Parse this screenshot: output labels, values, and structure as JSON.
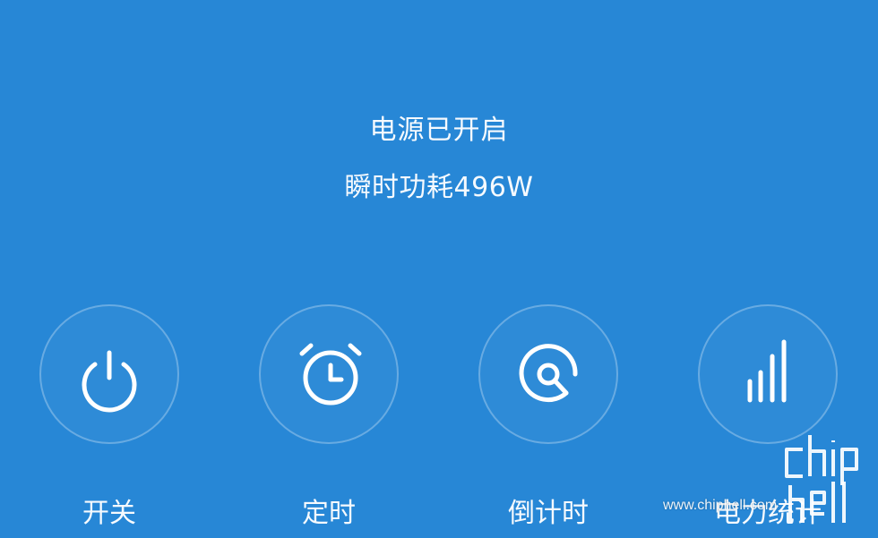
{
  "status": {
    "title": "电源已开启",
    "power": "瞬时功耗496W"
  },
  "controls": [
    {
      "label": "开关",
      "icon": "power-icon"
    },
    {
      "label": "定时",
      "icon": "alarm-clock-icon"
    },
    {
      "label": "倒计时",
      "icon": "countdown-icon"
    },
    {
      "label": "电力统计",
      "icon": "bar-chart-icon"
    }
  ],
  "watermark": {
    "url": "www.chiphell.com",
    "logo": "chip hell"
  },
  "colors": {
    "background": "#2787d6",
    "foreground": "#ffffff"
  }
}
